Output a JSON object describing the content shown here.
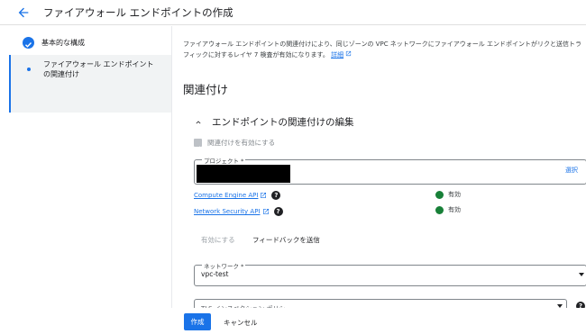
{
  "header": {
    "title": "ファイアウォール エンドポイントの作成"
  },
  "sidebar": {
    "steps": [
      {
        "label": "基本的な構成",
        "state": "completed"
      },
      {
        "label": "ファイアウォール エンドポイントの関連付け",
        "state": "active"
      }
    ]
  },
  "main": {
    "description": "ファイアウォール エンドポイントの関連付けにより、同じゾーンの VPC ネットワークにファイアウォール エンドポイントがリクと送信トラフィックに対するレイヤ 7 検査が有効になります。",
    "description_link": "詳細",
    "section_title": "関連付け",
    "card_title": "エンドポイントの関連付けの編集",
    "enable_checkbox_label": "関連付けを有効にする",
    "project_field": {
      "label": "プロジェクト *",
      "action": "選択"
    },
    "apis": [
      {
        "name": "Compute Engine API",
        "status": "有効"
      },
      {
        "name": "Network Security API",
        "status": "有効"
      }
    ],
    "enable_button": "有効にする",
    "feedback_button": "フィードバックを送信",
    "network_field": {
      "label": "ネットワーク *",
      "value": "vpc-test"
    },
    "tls_field": {
      "placeholder": "TLS インスペクション ポリシー"
    }
  },
  "footer": {
    "create": "作成",
    "cancel": "キャンセル"
  },
  "colors": {
    "accent": "#1a73e8",
    "success": "#188038"
  }
}
